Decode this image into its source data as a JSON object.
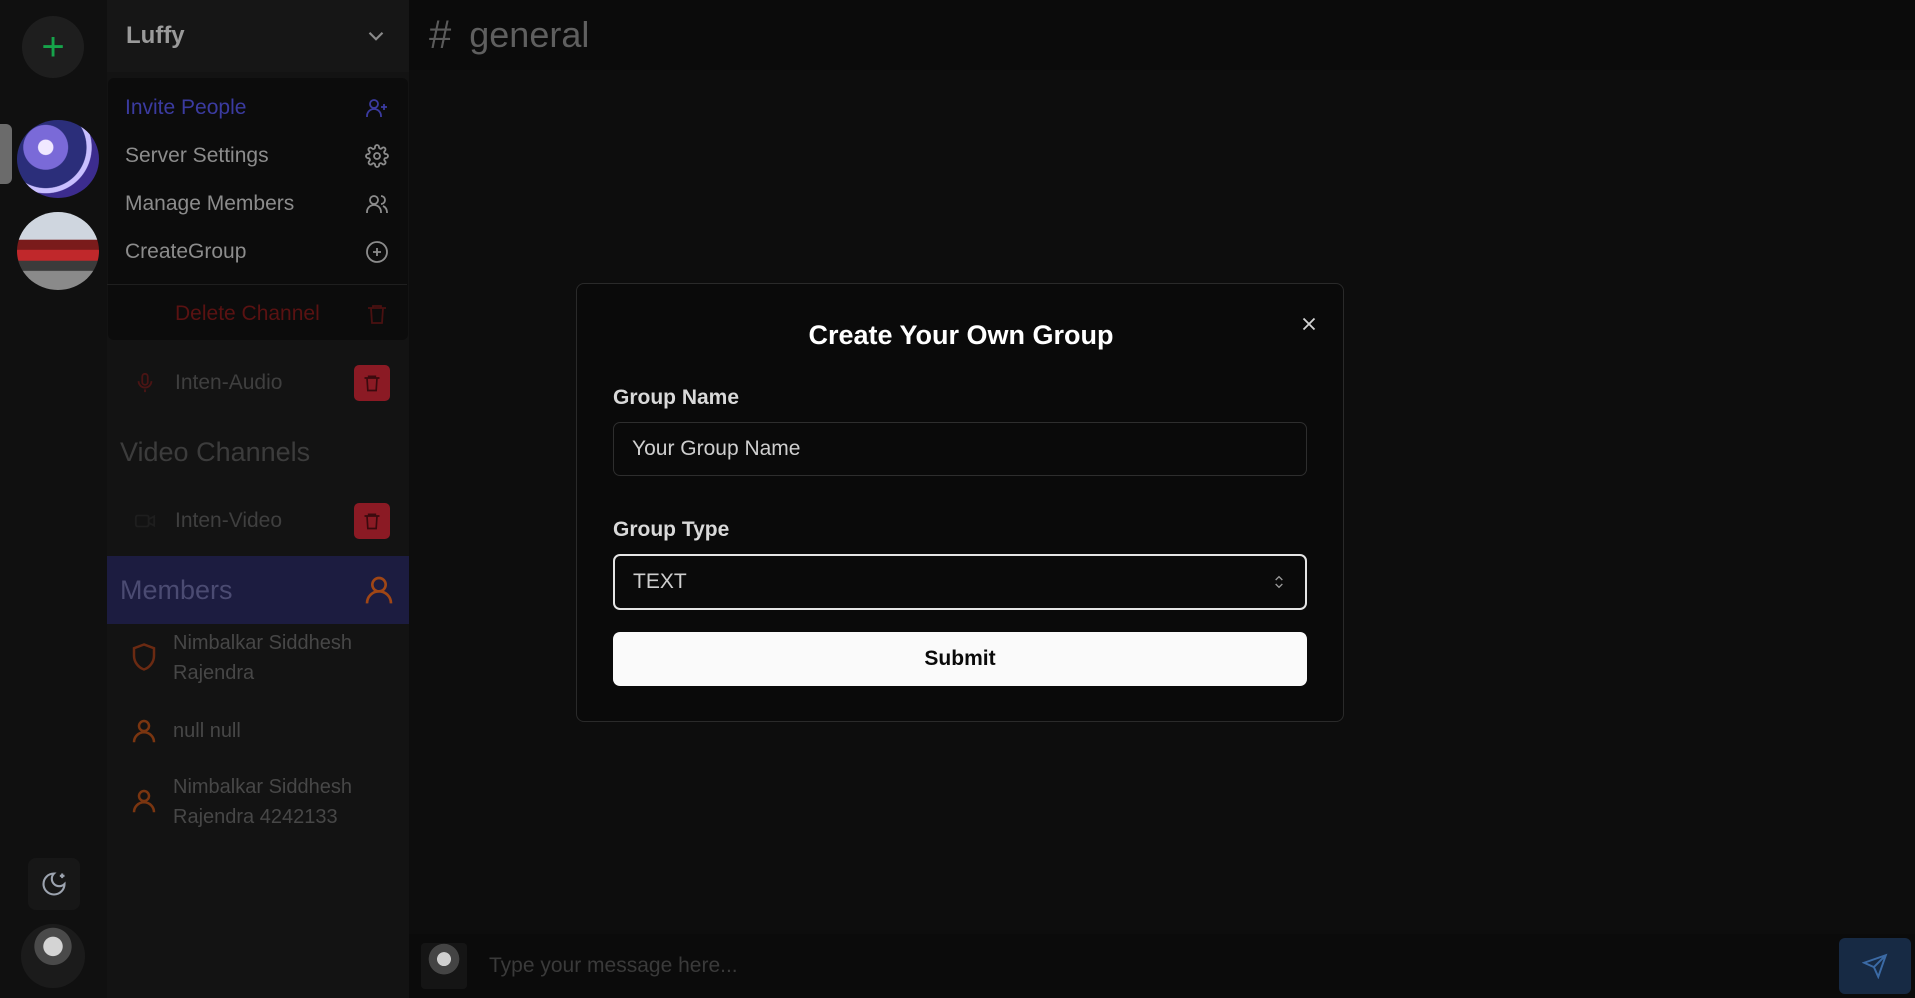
{
  "server": {
    "name": "Luffy"
  },
  "dropdown": {
    "items": [
      {
        "label": "Invite People",
        "icon": "user-plus-icon"
      },
      {
        "label": "Server Settings",
        "icon": "gear-icon"
      },
      {
        "label": "Manage Members",
        "icon": "users-icon"
      },
      {
        "label": "CreateGroup",
        "icon": "plus-circle-icon"
      },
      {
        "label": "Delete Channel",
        "icon": "trash-icon"
      }
    ]
  },
  "channels": {
    "audio": [
      {
        "label": "Inten-Audio"
      }
    ],
    "video_section_title": "Video Channels",
    "video": [
      {
        "label": "Inten-Video"
      }
    ]
  },
  "members": {
    "title": "Members",
    "list": [
      {
        "name": "Nimbalkar Siddhesh Rajendra"
      },
      {
        "name": "null null"
      },
      {
        "name": "Nimbalkar Siddhesh Rajendra 4242133"
      }
    ]
  },
  "main": {
    "channel_name": "general",
    "composer_placeholder": "Type your message here..."
  },
  "modal": {
    "title": "Create Your Own Group",
    "name_label": "Group Name",
    "name_placeholder": "Your Group Name",
    "type_label": "Group Type",
    "type_value": "TEXT",
    "submit_label": "Submit"
  },
  "colors": {
    "accent_add": "#16a34a",
    "danger": "#8b1a24",
    "members_header_bg": "#1c1c40",
    "send_button_bg": "#172a44"
  }
}
